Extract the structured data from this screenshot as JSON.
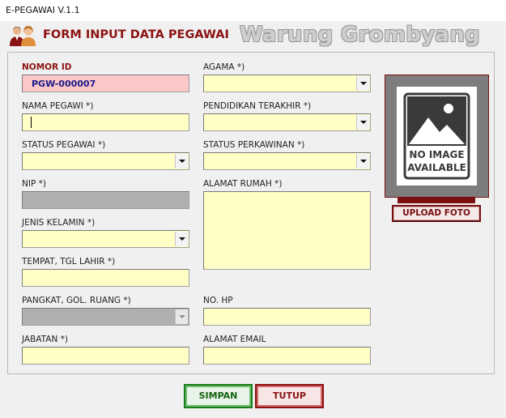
{
  "window": {
    "title": "E-PEGAWAI V.1.1"
  },
  "header": {
    "form_title": "FORM INPUT DATA PEGAWAI",
    "watermark": "Warung Grombyang"
  },
  "form": {
    "nomor_id": {
      "label": "NOMOR ID",
      "value": "PGW-000007"
    },
    "nama_pegawai": {
      "label": "NAMA PEGAWI *)",
      "value": ""
    },
    "status_pegawai": {
      "label": "STATUS PEGAWAI *)",
      "value": ""
    },
    "nip": {
      "label": "NIP *)",
      "value": ""
    },
    "jenis_kelamin": {
      "label": "JENIS KELAMIN *)",
      "value": ""
    },
    "tempat_tgl_lahir": {
      "label": "TEMPAT, TGL LAHIR *)",
      "value": ""
    },
    "pangkat_gol_ruang": {
      "label": "PANGKAT, GOL. RUANG *)",
      "value": ""
    },
    "jabatan": {
      "label": "JABATAN *)",
      "value": ""
    },
    "agama": {
      "label": "AGAMA *)",
      "value": ""
    },
    "pendidikan_terakhir": {
      "label": "PENDIDIKAN TERAKHIR *)",
      "value": ""
    },
    "status_perkawinan": {
      "label": "STATUS PERKAWINAN *)",
      "value": ""
    },
    "alamat_rumah": {
      "label": "ALAMAT RUMAH *)",
      "value": ""
    },
    "no_hp": {
      "label": "NO. HP",
      "value": ""
    },
    "alamat_email": {
      "label": "ALAMAT EMAIL",
      "value": ""
    }
  },
  "photo": {
    "placeholder_line1": "NO IMAGE",
    "placeholder_line2": "AVAILABLE",
    "upload_label": "UPLOAD FOTO"
  },
  "actions": {
    "save_label": "SIMPAN",
    "close_label": "TUTUP"
  },
  "colors": {
    "accent_red": "#8b1212",
    "field_yellow": "#ffffc6",
    "field_pink": "#fcc7c7",
    "field_disabled": "#b0b0b0",
    "save_green": "#1e7a1e"
  },
  "icons": {
    "header": "users-icon",
    "photo_placeholder": "image-placeholder-icon"
  }
}
